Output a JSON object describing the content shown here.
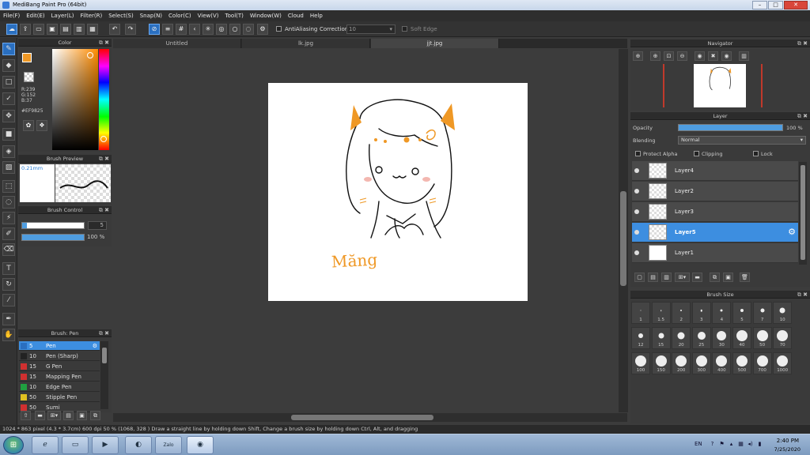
{
  "window": {
    "title": "MediBang Paint Pro (64bit)",
    "buttons": {
      "minimize": "–",
      "maximize": "□",
      "close": "✕"
    }
  },
  "menu": [
    "File(F)",
    "Edit(E)",
    "Layer(L)",
    "Filter(R)",
    "Select(S)",
    "Snap(N)",
    "Color(C)",
    "View(V)",
    "Tool(T)",
    "Window(W)",
    "Cloud",
    "Help"
  ],
  "toolbar": {
    "antialiasing_label": "AntiAliasing",
    "correction_label": "Correction",
    "correction_value": "10",
    "soft_edge_label": "Soft Edge"
  },
  "color_panel": {
    "title": "Color",
    "r": "R:239",
    "g": "G:152",
    "b": "B:37",
    "hex": "#EF9825",
    "fg_color": "#EF9825"
  },
  "brush_preview": {
    "title": "Brush Preview",
    "size": "0.21mm"
  },
  "brush_control": {
    "title": "Brush Control",
    "size_value": "5",
    "opacity_value": "100 %"
  },
  "brush_list": {
    "title": "Brush: Pen",
    "items": [
      {
        "size": "5",
        "name": "Pen",
        "color": "#2a6fc0",
        "active": true
      },
      {
        "size": "10",
        "name": "Pen (Sharp)",
        "color": "#222222"
      },
      {
        "size": "15",
        "name": "G Pen",
        "color": "#d03030"
      },
      {
        "size": "15",
        "name": "Mapping Pen",
        "color": "#d03030"
      },
      {
        "size": "10",
        "name": "Edge Pen",
        "color": "#20a040"
      },
      {
        "size": "50",
        "name": "Stipple Pen",
        "color": "#e0c020"
      },
      {
        "size": "50",
        "name": "Sumi",
        "color": "#d03030"
      }
    ]
  },
  "tabs": [
    "Untitled",
    "lk.jpg",
    "jjt.jpg"
  ],
  "canvas": {
    "handwritten_text": "Măng"
  },
  "navigator": {
    "title": "Navigator"
  },
  "layer_panel": {
    "title": "Layer",
    "opacity_label": "Opacity",
    "opacity_value": "100 %",
    "blending_label": "Blending",
    "blending_value": "Normal",
    "protect_alpha_label": "Protect Alpha",
    "clipping_label": "Clipping",
    "lock_label": "Lock",
    "layers": [
      {
        "name": "Layer4",
        "active": false,
        "white": false
      },
      {
        "name": "Layer2",
        "active": false,
        "white": false
      },
      {
        "name": "Layer3",
        "active": false,
        "white": false
      },
      {
        "name": "Layer5",
        "active": true,
        "white": false
      },
      {
        "name": "Layer1",
        "active": false,
        "white": true
      }
    ]
  },
  "brush_size_panel": {
    "title": "Brush Size",
    "sizes": [
      "1",
      "1.5",
      "2",
      "3",
      "4",
      "5",
      "7",
      "10",
      "12",
      "15",
      "20",
      "25",
      "30",
      "40",
      "50",
      "70",
      "100",
      "150",
      "200",
      "300",
      "400",
      "500",
      "700",
      "1000"
    ]
  },
  "statusbar": {
    "text": "1024 * 863 pixel   (4.3 * 3.7cm)   600 dpi   50 %   (1068, 328 )   Draw a straight line by holding down Shift, Change a brush size by holding down Ctrl, Alt, and dragging"
  },
  "taskbar": {
    "lang": "EN",
    "time": "2:40 PM",
    "date": "7/25/2020",
    "zalo": "Zalo"
  }
}
